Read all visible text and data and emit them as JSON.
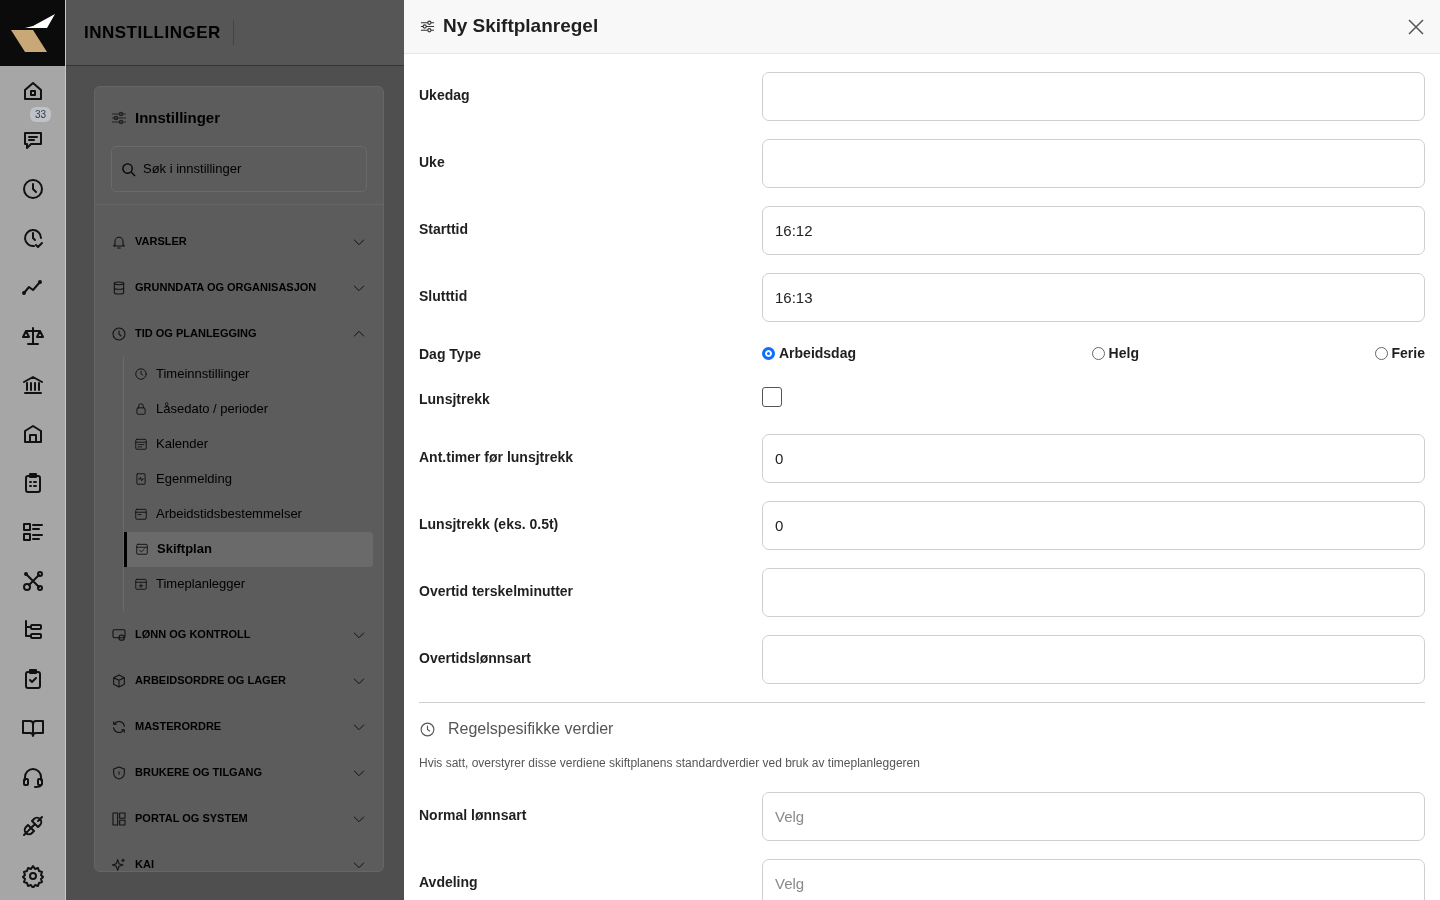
{
  "app_header": {
    "title": "INNSTILLINGER"
  },
  "rail": {
    "badge": "33"
  },
  "settings_panel": {
    "title": "Innstillinger",
    "search": {
      "placeholder": "Søk i innstillinger"
    },
    "sections": [
      {
        "label": "VARSLER",
        "expanded": false
      },
      {
        "label": "GRUNNDATA OG ORGANISASJON",
        "expanded": false
      },
      {
        "label": "TID OG PLANLEGGING",
        "expanded": true,
        "children": [
          {
            "label": "Timeinnstillinger",
            "selected": false
          },
          {
            "label": "Låsedato / perioder",
            "selected": false
          },
          {
            "label": "Kalender",
            "selected": false
          },
          {
            "label": "Egenmelding",
            "selected": false
          },
          {
            "label": "Arbeidstidsbestemmelser",
            "selected": false
          },
          {
            "label": "Skiftplan",
            "selected": true
          },
          {
            "label": "Timeplanlegger",
            "selected": false
          }
        ]
      },
      {
        "label": "LØNN OG KONTROLL",
        "expanded": false
      },
      {
        "label": "ARBEIDSORDRE OG LAGER",
        "expanded": false
      },
      {
        "label": "MASTERORDRE",
        "expanded": false
      },
      {
        "label": "BRUKERE OG TILGANG",
        "expanded": false
      },
      {
        "label": "PORTAL OG SYSTEM",
        "expanded": false
      },
      {
        "label": "KAI",
        "expanded": false
      }
    ]
  },
  "drawer": {
    "title": "Ny Skiftplanregel",
    "fields": [
      {
        "kind": "text",
        "label": "Ukedag"
      },
      {
        "kind": "text",
        "label": "Uke"
      },
      {
        "kind": "text",
        "label": "Starttid",
        "value": "16:12"
      },
      {
        "kind": "text",
        "label": "Slutttid",
        "value": "16:13"
      },
      {
        "kind": "radio",
        "label": "Dag Type",
        "options": [
          {
            "label": "Arbeidsdag",
            "selected": true
          },
          {
            "label": "Helg",
            "selected": false
          },
          {
            "label": "Ferie",
            "selected": false
          }
        ]
      },
      {
        "kind": "checkbox",
        "label": "Lunsjtrekk",
        "checked": false
      },
      {
        "kind": "text",
        "label": "Ant.timer før lunsjtrekk",
        "value": "0"
      },
      {
        "kind": "text",
        "label": "Lunsjtrekk (eks. 0.5t)",
        "value": "0"
      },
      {
        "kind": "text",
        "label": "Overtid terskelminutter"
      },
      {
        "kind": "text",
        "label": "Overtidslønnsart"
      }
    ],
    "section": {
      "title": "Regelspesifikke verdier",
      "note": "Hvis satt, overstyrer disse verdiene skiftplanens standardverdier ved bruk av timeplanleggeren"
    },
    "rule_fields": [
      {
        "kind": "select",
        "label": "Normal lønnsart",
        "placeholder": "Velg"
      },
      {
        "kind": "select",
        "label": "Avdeling",
        "placeholder": "Velg"
      }
    ]
  }
}
